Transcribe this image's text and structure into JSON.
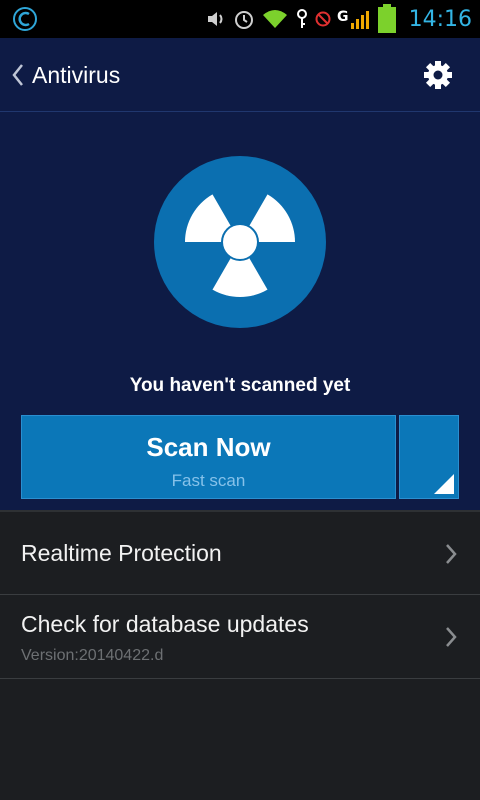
{
  "status_bar": {
    "time": "14:16",
    "icons": [
      "app-logo-icon",
      "volume-icon",
      "alarm-icon",
      "wifi-icon",
      "key-icon",
      "no-sim-icon",
      "g-signal-icon",
      "battery-icon"
    ],
    "accent_color": "#33b5e5"
  },
  "header": {
    "title": "Antivirus",
    "back_icon": "chevron-left-icon",
    "settings_icon": "gear-icon"
  },
  "hero": {
    "status_icon": "radiation-icon",
    "status_text": "You haven't scanned yet"
  },
  "scan": {
    "button_label": "Scan Now",
    "button_sublabel": "Fast scan",
    "options_icon": "corner-triangle-icon",
    "button_color": "#0b77b8"
  },
  "list": {
    "items": [
      {
        "label": "Realtime Protection"
      },
      {
        "label": "Check for database updates",
        "sublabel": "Version:20140422.d"
      }
    ]
  },
  "colors": {
    "hero_background": "#0e1b45",
    "list_background": "#1c1e21"
  }
}
